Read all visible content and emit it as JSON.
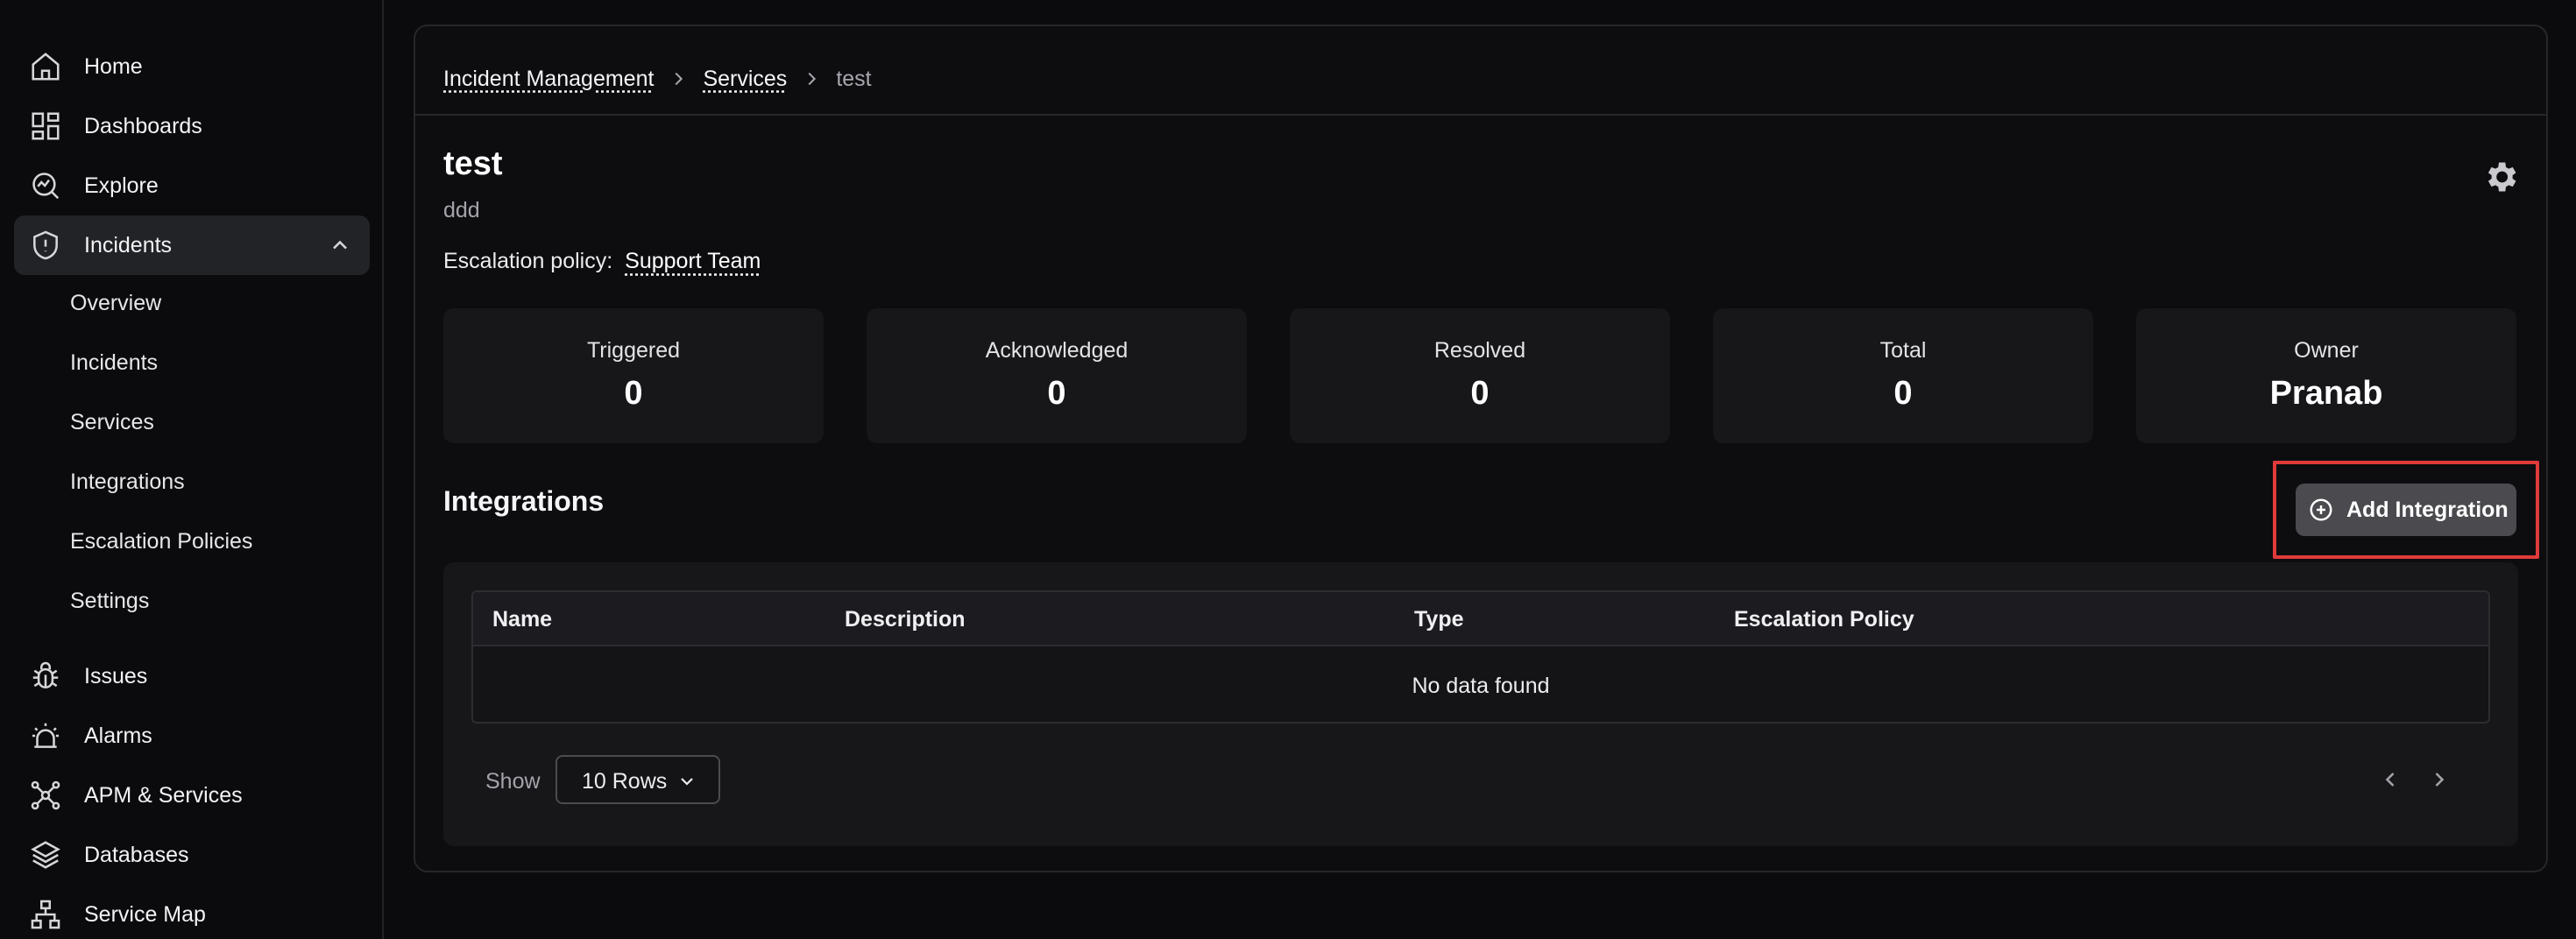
{
  "sidebar": {
    "items": [
      {
        "label": "Home",
        "icon": "home-icon"
      },
      {
        "label": "Dashboards",
        "icon": "dashboard-icon"
      },
      {
        "label": "Explore",
        "icon": "explore-icon"
      },
      {
        "label": "Incidents",
        "icon": "shield-alert-icon",
        "expanded": true
      },
      {
        "label": "Issues",
        "icon": "bug-icon"
      },
      {
        "label": "Alarms",
        "icon": "alarm-icon"
      },
      {
        "label": "APM & Services",
        "icon": "network-icon"
      },
      {
        "label": "Databases",
        "icon": "layers-icon"
      },
      {
        "label": "Service Map",
        "icon": "sitemap-icon"
      }
    ],
    "incident_sub": [
      {
        "label": "Overview"
      },
      {
        "label": "Incidents"
      },
      {
        "label": "Services"
      },
      {
        "label": "Integrations"
      },
      {
        "label": "Escalation Policies"
      },
      {
        "label": "Settings"
      }
    ]
  },
  "breadcrumb": {
    "items": [
      "Incident Management",
      "Services"
    ],
    "current": "test"
  },
  "service": {
    "title": "test",
    "description": "ddd",
    "escalation_label": "Escalation policy:",
    "escalation_value": "Support Team"
  },
  "stats": [
    {
      "label": "Triggered",
      "value": "0"
    },
    {
      "label": "Acknowledged",
      "value": "0"
    },
    {
      "label": "Resolved",
      "value": "0"
    },
    {
      "label": "Total",
      "value": "0"
    },
    {
      "label": "Owner",
      "value": "Pranab"
    }
  ],
  "integrations": {
    "title": "Integrations",
    "add_label": "Add Integration",
    "columns": [
      "Name",
      "Description",
      "Type",
      "Escalation Policy"
    ],
    "empty_text": "No data found",
    "show_label": "Show",
    "rows_value": "10 Rows"
  },
  "colors": {
    "background": "#0b0b0d",
    "card": "#17171a",
    "highlight": "#e03a3a",
    "button": "#4a4a4f"
  }
}
